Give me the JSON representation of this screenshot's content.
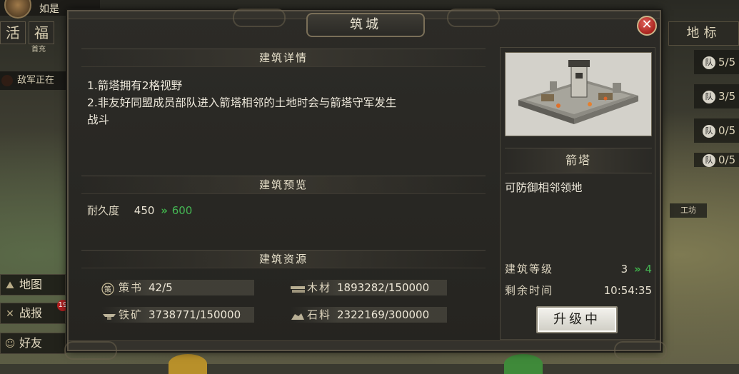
{
  "background": {
    "player_name": "如是",
    "chips": [
      "活",
      "福"
    ],
    "chip_sub": "首充",
    "notice": "敌军正在",
    "side_buttons": [
      {
        "icon": "map-icon",
        "label": "地图"
      },
      {
        "icon": "battle-report-icon",
        "label": "战报"
      },
      {
        "icon": "friends-icon",
        "label": "好友"
      }
    ],
    "battle_badge": "19",
    "right_title": "地标",
    "queues": [
      {
        "icon": "队",
        "value": "5/5"
      },
      {
        "icon": "队",
        "value": "3/5"
      },
      {
        "icon": "队",
        "value": "0/5"
      },
      {
        "icon": "队",
        "value": "0/5"
      }
    ],
    "map_label": "工坊"
  },
  "dialog": {
    "title": "筑城",
    "close_icon": "close-icon",
    "detail_section_title": "建筑详情",
    "details": [
      "1.箭塔拥有2格视野",
      "2.非友好同盟成员部队进入箭塔相邻的土地时会与箭塔守军发生",
      "战斗"
    ],
    "preview_section_title": "建筑预览",
    "preview": {
      "label": "耐久度",
      "current": "450",
      "arrow": "»",
      "next": "600"
    },
    "resource_section_title": "建筑资源",
    "resources": [
      {
        "icon": "strategy-book-icon",
        "name": "策书",
        "value": "42/5"
      },
      {
        "icon": "wood-icon",
        "name": "木材",
        "value": "1893282/150000"
      },
      {
        "icon": "iron-ore-icon",
        "name": "铁矿",
        "value": "3738771/150000"
      },
      {
        "icon": "stone-icon",
        "name": "石料",
        "value": "2322169/300000"
      }
    ],
    "building": {
      "image": "arrow-tower-fortress-image",
      "name": "箭塔",
      "description": "可防御相邻领地",
      "level_label": "建筑等级",
      "level_current": "3",
      "level_arrow": "»",
      "level_next": "4",
      "time_label": "剩余时间",
      "time_value": "10:54:35",
      "button_label": "升级中"
    }
  },
  "colors": {
    "accent_green": "#45b654",
    "close_red": "#b8302a",
    "panel_bg": "#2a2925"
  }
}
